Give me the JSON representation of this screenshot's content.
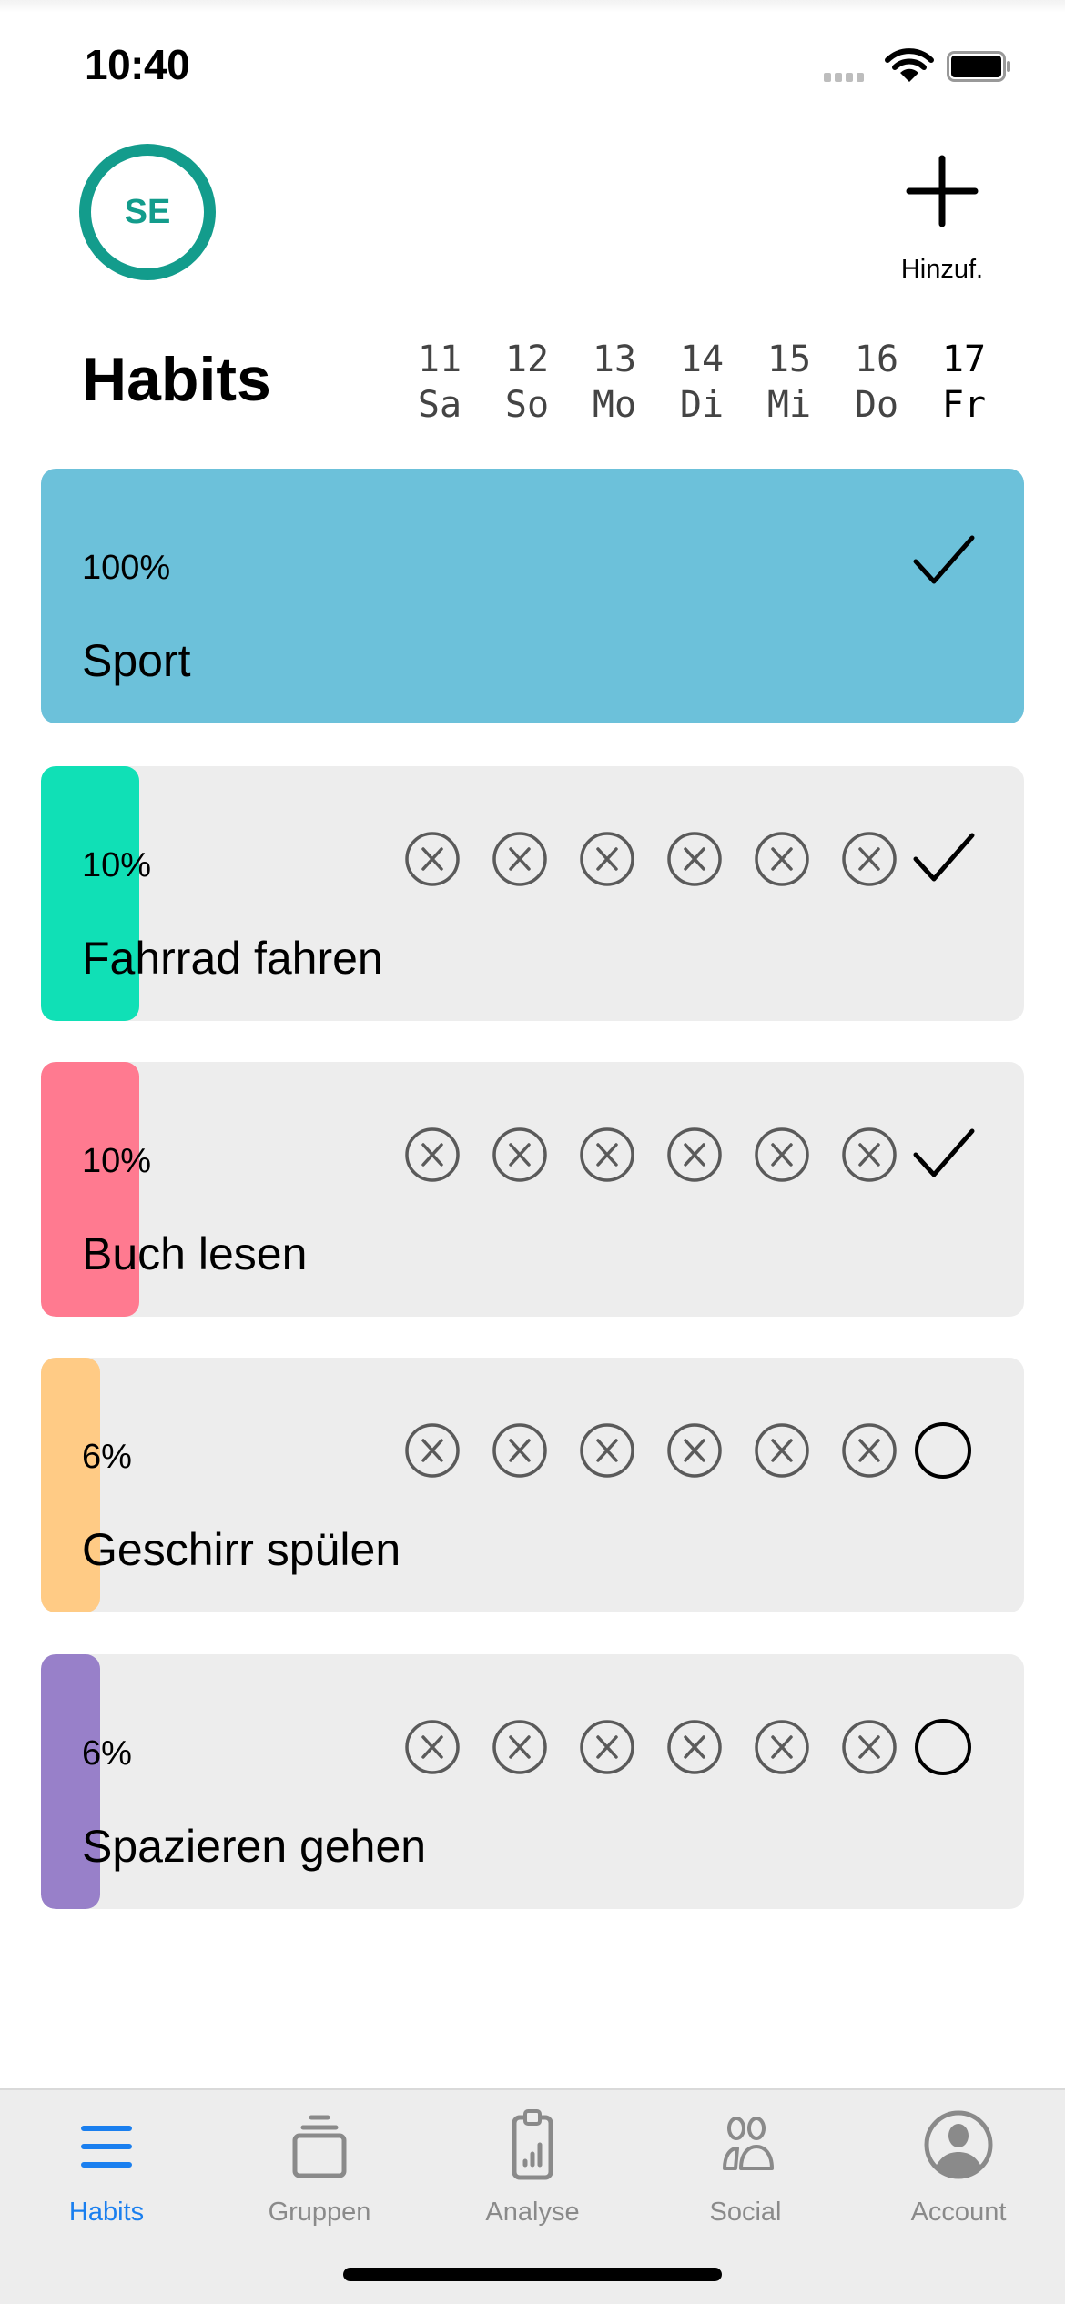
{
  "status_bar": {
    "time": "10:40",
    "wifi_icon": "wifi-icon",
    "battery_icon": "battery-icon"
  },
  "header": {
    "avatar_initials": "SE",
    "add_label": "Hinzuf.",
    "title": "Habits",
    "dates": [
      {
        "num": "11",
        "day": "Sa"
      },
      {
        "num": "12",
        "day": "So"
      },
      {
        "num": "13",
        "day": "Mo"
      },
      {
        "num": "14",
        "day": "Di"
      },
      {
        "num": "15",
        "day": "Mi"
      },
      {
        "num": "16",
        "day": "Do"
      },
      {
        "num": "17",
        "day": "Fr"
      }
    ]
  },
  "colors": {
    "accent": "#1a7fef",
    "avatar": "#139c8c",
    "card_bg": "#ededed"
  },
  "habits": [
    {
      "name": "Sport",
      "percent_label": "100%",
      "progress": 1.0,
      "color": "#6cc1da",
      "days": [],
      "today": "done"
    },
    {
      "name": "Fahrrad fahren",
      "percent_label": "10%",
      "progress": 0.1,
      "color": "#10e0b6",
      "days": [
        "missed",
        "missed",
        "missed",
        "missed",
        "missed",
        "missed"
      ],
      "today": "done"
    },
    {
      "name": "Buch lesen",
      "percent_label": "10%",
      "progress": 0.1,
      "color": "#ff7a90",
      "days": [
        "missed",
        "missed",
        "missed",
        "missed",
        "missed",
        "missed"
      ],
      "today": "done"
    },
    {
      "name": "Geschirr spülen",
      "percent_label": "6%",
      "progress": 0.06,
      "color": "#ffcb85",
      "days": [
        "missed",
        "missed",
        "missed",
        "missed",
        "missed",
        "missed"
      ],
      "today": "open"
    },
    {
      "name": "Spazieren gehen",
      "percent_label": "6%",
      "progress": 0.06,
      "color": "#9880c9",
      "days": [
        "missed",
        "missed",
        "missed",
        "missed",
        "missed",
        "missed"
      ],
      "today": "open"
    }
  ],
  "tabbar": {
    "items": [
      {
        "label": "Habits",
        "icon": "list-icon",
        "active": true
      },
      {
        "label": "Gruppen",
        "icon": "stack-icon",
        "active": false
      },
      {
        "label": "Analyse",
        "icon": "clipboard-chart-icon",
        "active": false
      },
      {
        "label": "Social",
        "icon": "people-icon",
        "active": false
      },
      {
        "label": "Account",
        "icon": "person-circle-icon",
        "active": false
      }
    ]
  }
}
